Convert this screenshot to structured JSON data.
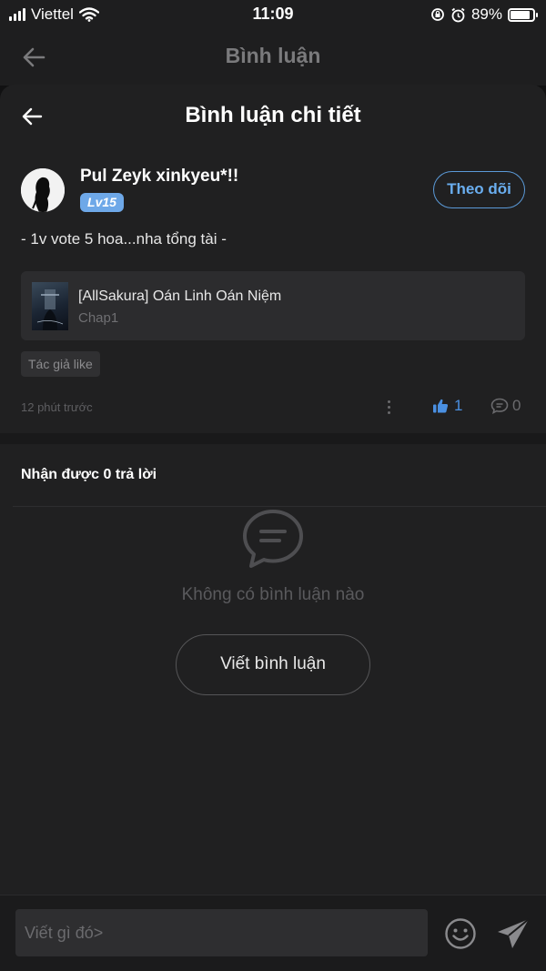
{
  "status_bar": {
    "carrier": "Viettel",
    "time": "11:09",
    "battery": "89%",
    "battery_level": 0.89
  },
  "background_header": {
    "title": "Bình luận"
  },
  "sheet": {
    "title": "Bình luận chi tiết"
  },
  "comment": {
    "username": "Pul Zeyk xinkyeu*!!",
    "level": "Lv15",
    "follow_label": "Theo dõi",
    "text": "- 1v vote 5 hoa...nha tổng tài -",
    "story": {
      "title": "[AllSakura] Oán Linh Oán Niệm",
      "chapter": "Chap1"
    },
    "tag": "Tác giả like",
    "time_ago": "12 phút trước",
    "likes": "1",
    "replies": "0"
  },
  "replies_section": {
    "title": "Nhận được 0 trả lời",
    "empty_text": "Không có bình luận nào",
    "write_button": "Viết bình luận"
  },
  "input_bar": {
    "placeholder": "Viết gì đó>"
  },
  "colors": {
    "accent": "#4a90e2",
    "background": "#202021",
    "level_badge": "#6ea8e8"
  }
}
